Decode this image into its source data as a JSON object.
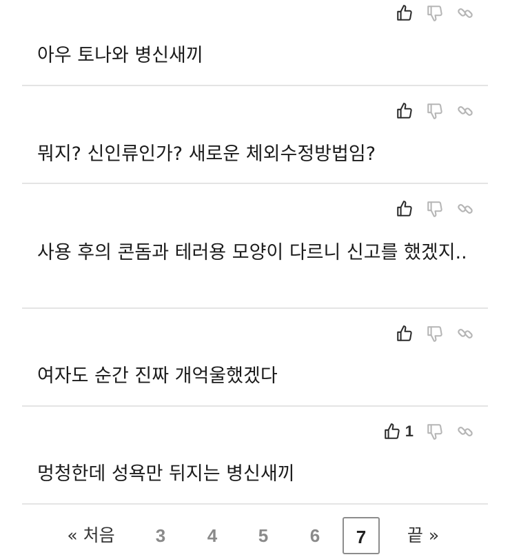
{
  "comments": [
    {
      "text": "아우 토나와 병신새끼",
      "likes": ""
    },
    {
      "text": "뭐지? 신인류인가? 새로운 체외수정방법임?",
      "likes": ""
    },
    {
      "text": "사용 후의 콘돔과 테러용 모양이 다르니 신고를 했겠지..",
      "likes": ""
    },
    {
      "text": "여자도 순간 진짜 개억울했겠다",
      "likes": ""
    },
    {
      "text": "멍청한데 성욕만 뒤지는 병신새끼",
      "likes": "1"
    }
  ],
  "icons": {
    "like": "thumbs-up-icon",
    "dislike": "thumbs-down-icon",
    "link": "link-icon"
  },
  "pagination": {
    "first": "« 처음",
    "pages": [
      "3",
      "4",
      "5",
      "6",
      "7"
    ],
    "current": "7",
    "last": "끝 »"
  },
  "colors": {
    "divider": "#e4e4e4",
    "icon_dark": "#2b2b2b",
    "icon_light": "#b5b5b5"
  }
}
